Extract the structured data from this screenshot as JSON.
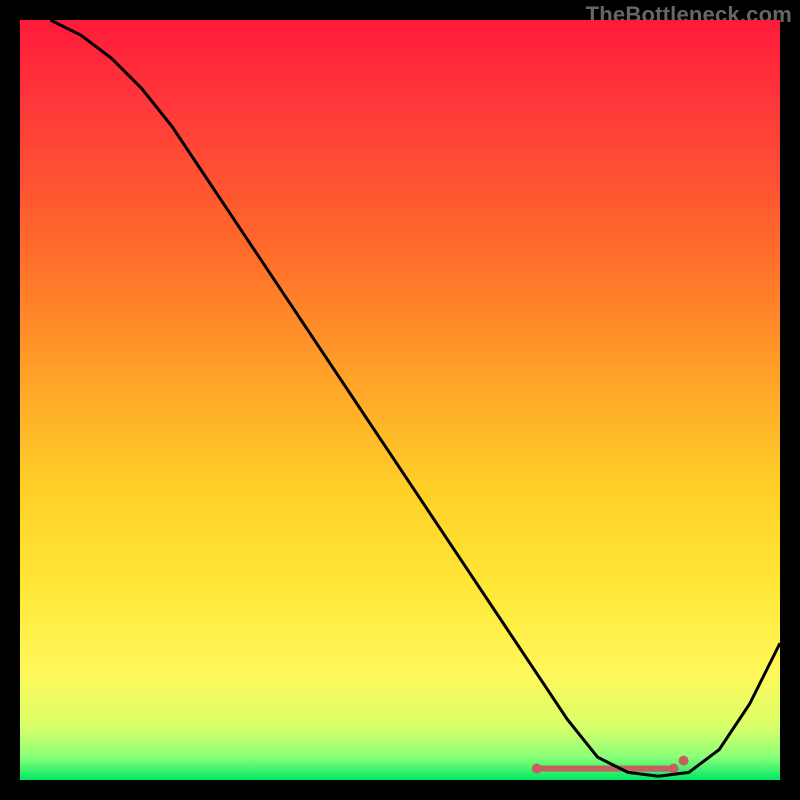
{
  "watermark": "TheBottleneck.com",
  "chart_data": {
    "type": "line",
    "title": "",
    "xlabel": "",
    "ylabel": "",
    "xlim": [
      0,
      100
    ],
    "ylim": [
      0,
      100
    ],
    "grid": false,
    "legend": false,
    "gradient": {
      "stops": [
        {
          "offset": 0.0,
          "color": "#ff1a3a"
        },
        {
          "offset": 0.12,
          "color": "#ff3a3a"
        },
        {
          "offset": 0.3,
          "color": "#ff6a2a"
        },
        {
          "offset": 0.48,
          "color": "#ffa628"
        },
        {
          "offset": 0.62,
          "color": "#ffd028"
        },
        {
          "offset": 0.75,
          "color": "#ffe838"
        },
        {
          "offset": 0.86,
          "color": "#fff85a"
        },
        {
          "offset": 0.93,
          "color": "#d8ff6a"
        },
        {
          "offset": 0.97,
          "color": "#8aff78"
        },
        {
          "offset": 1.0,
          "color": "#00e864"
        }
      ]
    },
    "series": [
      {
        "name": "bottleneck-curve",
        "color": "#000000",
        "stroke_width": 3,
        "x": [
          4,
          8,
          12,
          16,
          20,
          24,
          28,
          32,
          36,
          40,
          44,
          48,
          52,
          56,
          60,
          64,
          68,
          72,
          76,
          80,
          84,
          88,
          92,
          96,
          100
        ],
        "y": [
          100,
          98,
          95,
          91,
          86,
          80,
          74,
          68,
          62,
          56,
          50,
          44,
          38,
          32,
          26,
          20,
          14,
          8,
          3,
          1,
          0.5,
          1,
          4,
          10,
          18
        ]
      }
    ],
    "marker_band": {
      "name": "optimal-range",
      "color": "#c66060",
      "x_start": 68,
      "x_end": 86,
      "y": 1.5,
      "dot_radius": 5,
      "band_height": 6
    }
  }
}
